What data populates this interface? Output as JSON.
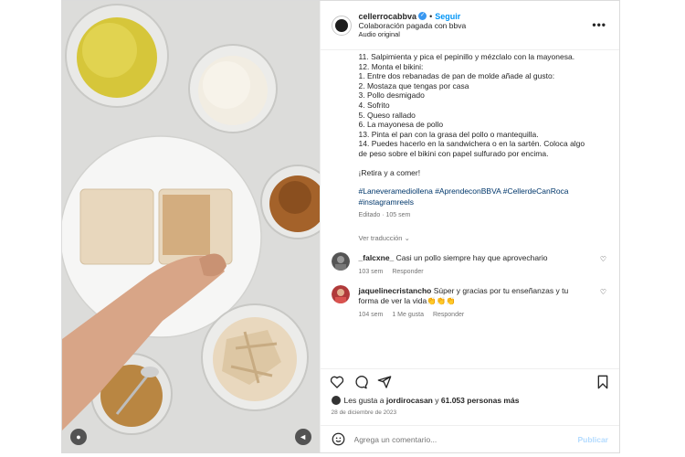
{
  "post": {
    "username": "cellerrocabbva",
    "follow_label": "Seguir",
    "separator": "•",
    "collab_text": "Colaboración pagada con bbva",
    "audio_text": "Audio original",
    "more_label": "•••"
  },
  "caption": {
    "lines": [
      "11. Salpimienta y pica el pepinillo y mézclalo con la mayonesa.",
      "12. Monta el bikini:",
      "1. Entre dos rebanadas de pan de molde añade al gusto:",
      "2. Mostaza que tengas por casa",
      "3. Pollo desmigado",
      "4. Sofrito",
      "5. Queso rallado",
      "6. La mayonesa de pollo",
      "13. Pinta el pan con la grasa del pollo o mantequilla.",
      "14. Puedes hacerlo en la sandwichera o en la sartén. Coloca algo",
      "de peso sobre el bikini con papel sulfurado por encima."
    ],
    "closing": "¡Retira y a comer!",
    "hashtags": [
      "#Laneveramediollena",
      "#AprendeconBBVA",
      "#CellerdeCanRoca",
      "#instagramreels"
    ],
    "edited": "Editado · 105 sem",
    "translate": "Ver traducción"
  },
  "comments": [
    {
      "user": "_falcxne_",
      "text": "Casi un pollo siempre hay que aprovechario",
      "time": "103 sem",
      "reply": "Responder",
      "likes": ""
    },
    {
      "user": "jaquelinecristancho",
      "text": "Súper y gracias por tu enseñanzas y tu",
      "text2": "forma de ver la vida👏👏👏",
      "time": "104 sem",
      "likes": "1 Me gusta",
      "reply": "Responder"
    }
  ],
  "likes": {
    "prefix": "Les gusta a ",
    "user": "jordirocasan",
    "middle": " y ",
    "count": "61.053 personas más"
  },
  "date": "28 de diciembre de 2023",
  "comment_box": {
    "placeholder": "Agrega un comentario...",
    "post_label": "Publicar"
  },
  "icons": [
    "heart-icon",
    "comment-icon",
    "share-icon",
    "bookmark-icon",
    "emoji-icon",
    "volume-icon",
    "person-tag-icon",
    "more-icon"
  ]
}
